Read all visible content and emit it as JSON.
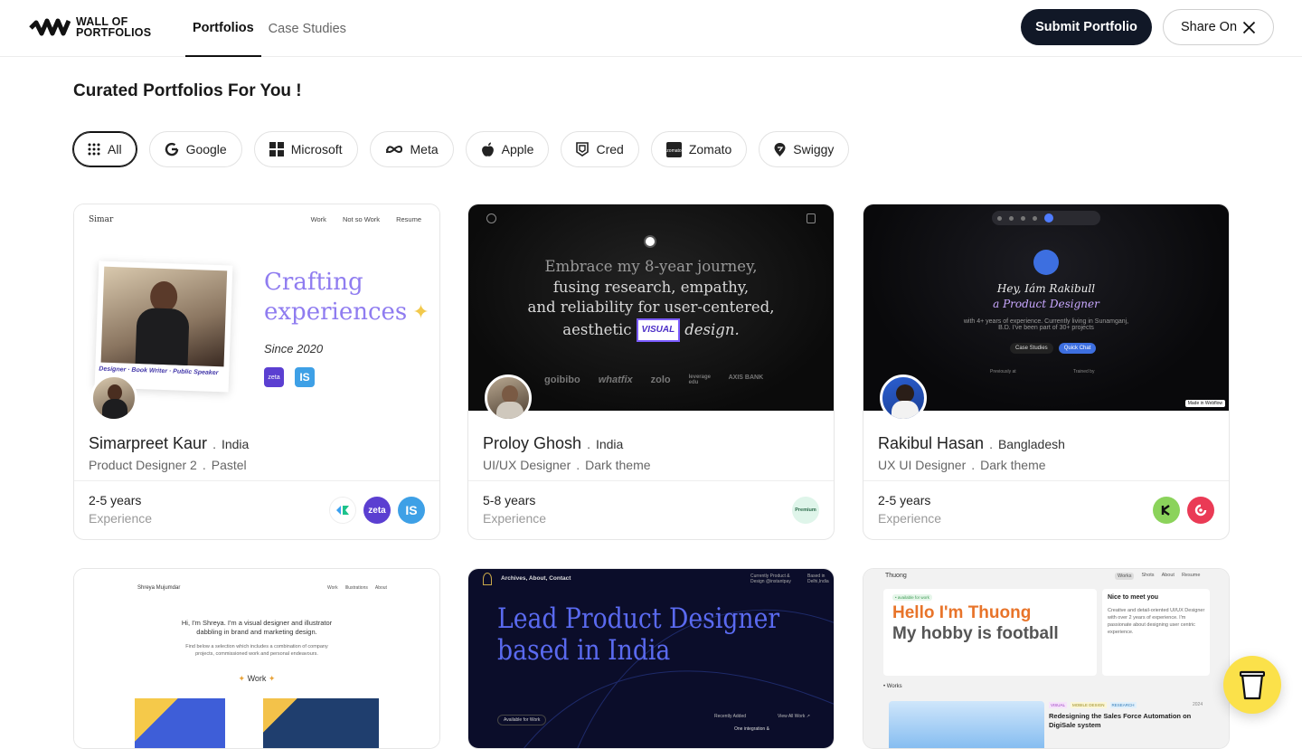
{
  "app": {
    "logo_line1": "WALL OF",
    "logo_line2": "PORTFOLIOS"
  },
  "nav": {
    "tabs": [
      {
        "label": "Portfolios",
        "active": true
      },
      {
        "label": "Case Studies",
        "active": false
      }
    ]
  },
  "header": {
    "submit_label": "Submit Portfolio",
    "share_label": "Share On"
  },
  "page": {
    "title": "Curated Portfolios For You !"
  },
  "filters": [
    {
      "label": "All",
      "icon": "grid-icon",
      "active": true
    },
    {
      "label": "Google",
      "icon": "google-icon"
    },
    {
      "label": "Microsoft",
      "icon": "microsoft-icon"
    },
    {
      "label": "Meta",
      "icon": "meta-icon"
    },
    {
      "label": "Apple",
      "icon": "apple-icon"
    },
    {
      "label": "Cred",
      "icon": "cred-icon"
    },
    {
      "label": "Zomato",
      "icon": "zomato-icon"
    },
    {
      "label": "Swiggy",
      "icon": "swiggy-icon"
    }
  ],
  "cards": [
    {
      "name": "Simarpreet Kaur",
      "country": "India",
      "role": "Product Designer 2",
      "style": "Pastel",
      "experience": "2-5 years",
      "experience_label": "Experience",
      "preview": {
        "brand": "Simar",
        "nav": [
          "Work",
          "Not so Work",
          "Resume"
        ],
        "headline1": "Crafting",
        "headline2": "experiences",
        "since": "Since 2020",
        "caption": "Designer · Book Writer · Public Speaker"
      },
      "badges": [
        {
          "text": "",
          "color": "#ffffff"
        },
        {
          "text": "zeta",
          "color": "#5b3fd1"
        },
        {
          "text": "IS",
          "color": "#3ea0e6"
        }
      ]
    },
    {
      "name": "Proloy Ghosh",
      "country": "India",
      "role": "UI/UX Designer",
      "style": "Dark theme",
      "experience": "5-8 years",
      "experience_label": "Experience",
      "preview": {
        "line1": "Embrace my 8-year journey,",
        "line2": "fusing research, empathy,",
        "line3": "and reliability for user-centered,",
        "line4a": "aesthetic",
        "tag": "VISUAL",
        "line4b": "design.",
        "logos": [
          "goibibo",
          "whatfix",
          "zolo",
          "leverage edu",
          "AXIS BANK"
        ]
      },
      "badges": [
        {
          "text": "Premium",
          "color": "#dff5ea"
        }
      ]
    },
    {
      "name": "Rakibul Hasan",
      "country": "Bangladesh",
      "role": "UX UI Designer",
      "style": "Dark theme",
      "experience": "2-5 years",
      "experience_label": "Experience",
      "preview": {
        "hey": "Hey, Iám Rakibull",
        "title": "a Product Designer",
        "sub1": "with 4+ years of experience. Currently living in Sunamganj,",
        "sub2": "B.D. I've been part of 30+ projects",
        "btn1": "Case Studies",
        "btn2": "Quick Chat",
        "webflow": "Made in Webflow",
        "prev": "Previously at",
        "trained": "Trained by"
      },
      "badges": [
        {
          "text": "",
          "color": "#8bd35b"
        },
        {
          "text": "",
          "color": "#ea3a55"
        }
      ]
    },
    {
      "preview": {
        "brand": "Shreya Mujumdar",
        "nav": [
          "Work",
          "Illustrations",
          "About"
        ],
        "intro1": "Hi, I'm Shreya. I'm a visual designer and illustrator",
        "intro2": "dabbling in brand and marketing design.",
        "intro3": "Find below a selection which includes a combination of company",
        "intro4": "projects, commissioned work and personal endeavours.",
        "work": "Work"
      }
    },
    {
      "preview": {
        "nav": "Archives, About, Contact",
        "right1": "Currently Product &",
        "right2": "Design @instantpay",
        "right3": "Based in",
        "right4": "Delhi,India",
        "h1": "Lead Product Designer",
        "h2": "based in India",
        "available": "Available for Work",
        "recent": "Recently Added",
        "viewall": "View All Work ↗",
        "item": "One integration &"
      }
    },
    {
      "preview": {
        "brand": "Thuong",
        "nav": [
          "Works",
          "Shots",
          "About",
          "Resume"
        ],
        "avail": "• available for work",
        "hello": "Hello I'm Thuong",
        "hobby": "My hobby is football",
        "nice": "Nice to meet you",
        "about": "Creative and detail-oriented UI/UX Designer with over 2 years of experience. I'm passionate about designing user centric experience.",
        "works": "• Works",
        "tags": [
          "VISUAL",
          "MOBILE DESIGN",
          "RESEARCH"
        ],
        "year": "2024",
        "project": "Redesigning the Sales Force Automation on DigiSale system"
      }
    }
  ],
  "colors": {
    "accent": "#111827",
    "fab": "#fbe14a",
    "purple": "#8f7cf0"
  }
}
